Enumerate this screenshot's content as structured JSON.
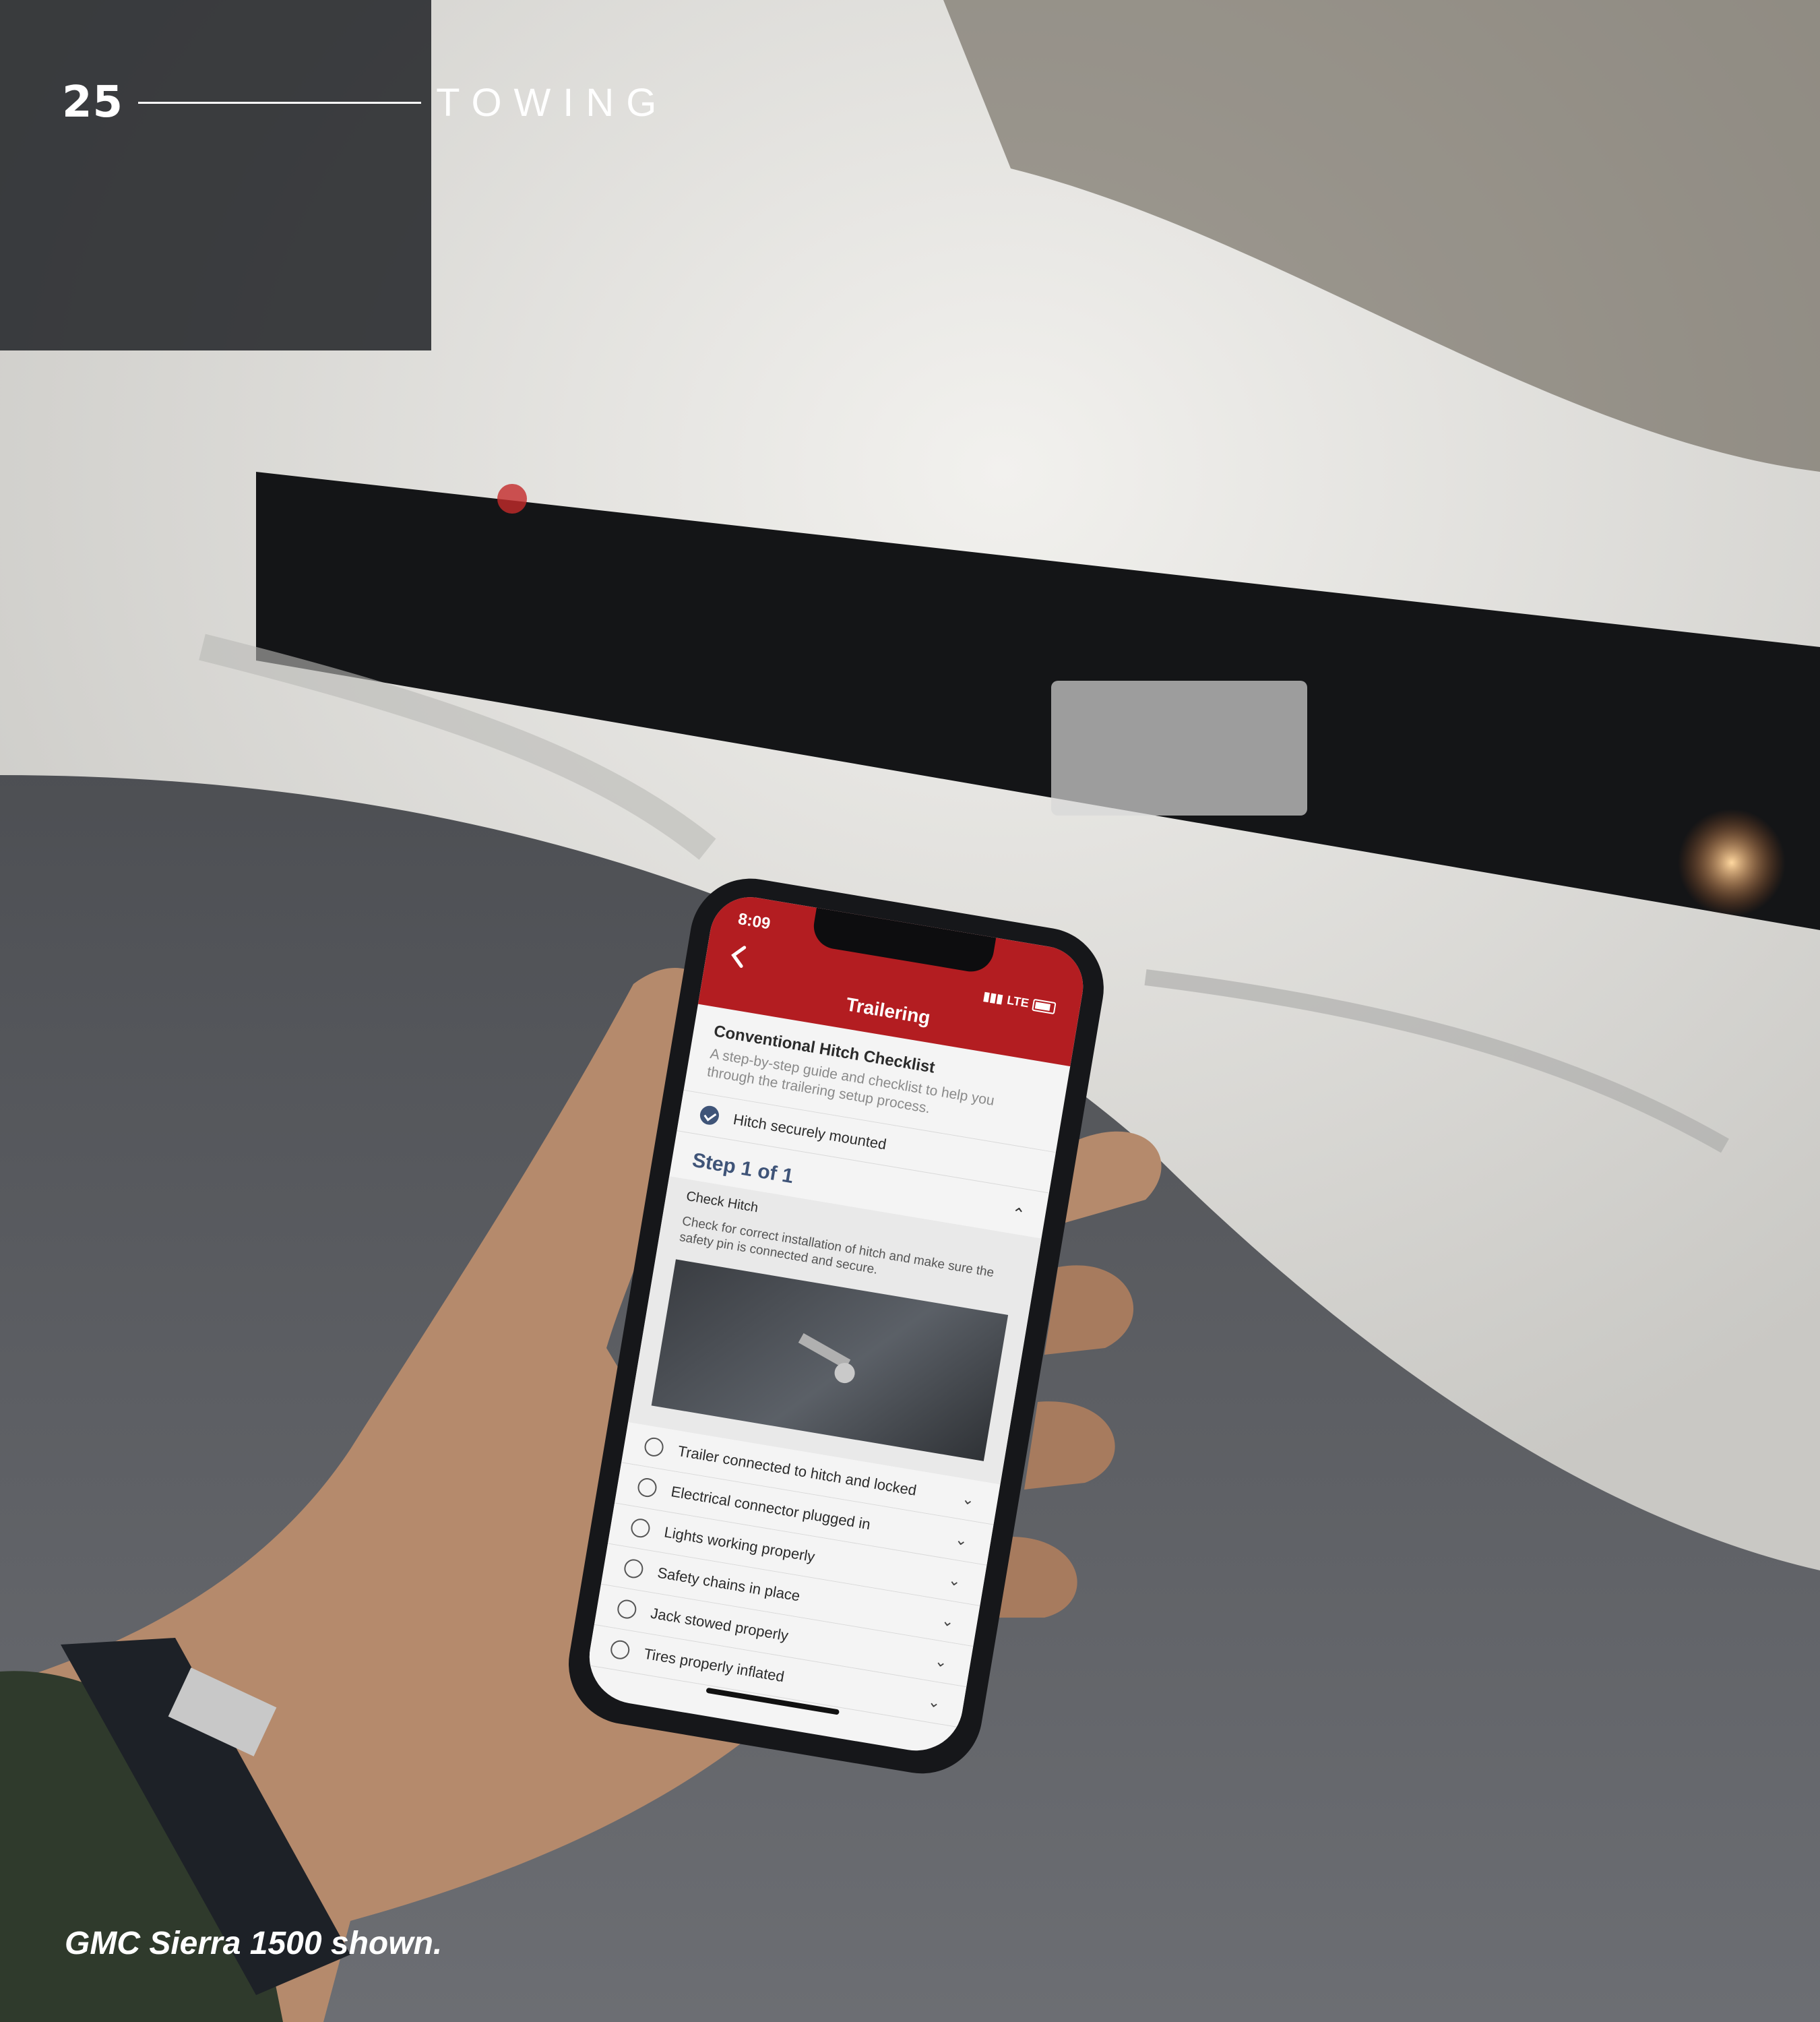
{
  "page": {
    "number": "25",
    "section": "TOWING",
    "caption": "GMC Sierra 1500 shown."
  },
  "colors": {
    "accent_red": "#b31d21",
    "step_blue": "#3f5478",
    "overlay_text": "#ffffff"
  },
  "phone": {
    "status": {
      "time": "8:09",
      "network": "LTE"
    },
    "app_bar": {
      "title": "Trailering",
      "back_icon": "chevron-left-icon"
    },
    "checklist": {
      "title": "Conventional Hitch Checklist",
      "description": "A step-by-step guide and checklist to help you through the trailering setup process."
    },
    "completed_item": {
      "label": "Hitch securely mounted",
      "checked": true
    },
    "step": {
      "title": "Step 1 of 1",
      "label": "Check Hitch",
      "description": "Check for correct installation of hitch and make sure the safety pin is connected and secure."
    },
    "items": [
      {
        "label": "Trailer connected to hitch and locked",
        "checked": false
      },
      {
        "label": "Electrical connector plugged in",
        "checked": false
      },
      {
        "label": "Lights working properly",
        "checked": false
      },
      {
        "label": "Safety chains in place",
        "checked": false
      },
      {
        "label": "Jack stowed properly",
        "checked": false
      },
      {
        "label": "Tires properly inflated",
        "checked": false
      }
    ]
  }
}
